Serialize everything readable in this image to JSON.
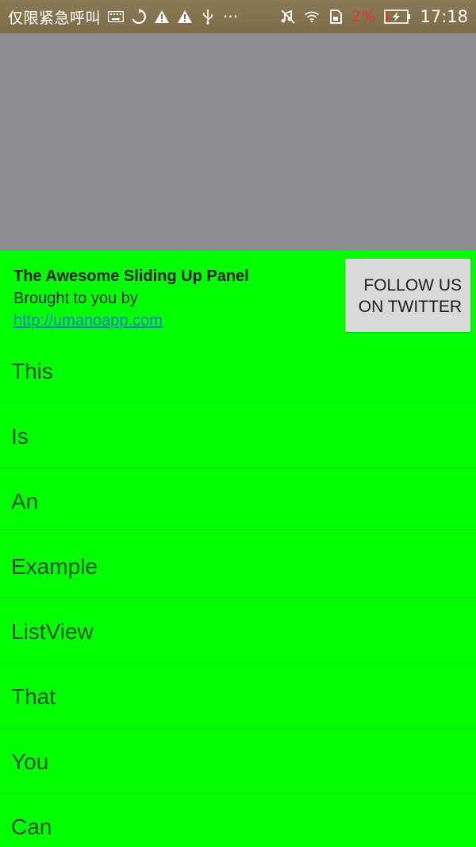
{
  "status_bar": {
    "carrier": "仅限紧急呼叫",
    "icons": [
      "keyboard-icon",
      "sync-icon",
      "warning-icon",
      "warning-icon",
      "usb-icon",
      "more-icon",
      "mute-icon",
      "wifi-icon",
      "sim-icon"
    ],
    "more": "···",
    "battery_percent": "2%",
    "time": "17:18",
    "battery_color": "#e8332a"
  },
  "panel": {
    "background_color": "#00ff00",
    "title": "The Awesome Sliding Up Panel",
    "subtitle": "Brought to you by",
    "link": "http://umanoapp.com",
    "follow_button_line1": "FOLLOW US",
    "follow_button_line2": "ON TWITTER"
  },
  "list": {
    "items": [
      "This",
      "Is",
      "An",
      "Example",
      "ListView",
      "That",
      "You",
      "Can"
    ]
  }
}
